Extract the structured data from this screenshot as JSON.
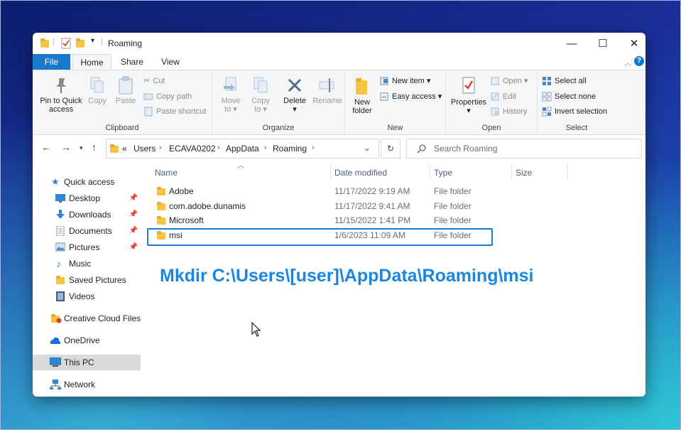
{
  "window": {
    "title": "Roaming",
    "controls": {
      "minimize": "—",
      "maximize": "☐",
      "close": "✕"
    }
  },
  "ribbon_tabs": [
    {
      "label": "File"
    },
    {
      "label": "Home"
    },
    {
      "label": "Share"
    },
    {
      "label": "View"
    }
  ],
  "ribbon": {
    "clipboard": {
      "label": "Clipboard",
      "pin_to_quick_access": [
        "Pin to Quick",
        "access"
      ],
      "copy": "Copy",
      "paste": "Paste",
      "cut": "Cut",
      "copy_path": "Copy path",
      "paste_shortcut": "Paste shortcut"
    },
    "organize": {
      "label": "Organize",
      "move_to": [
        "Move",
        "to"
      ],
      "copy_to": [
        "Copy",
        "to"
      ],
      "delete": "Delete",
      "rename": "Rename"
    },
    "new": {
      "label": "New",
      "new_folder": [
        "New",
        "folder"
      ],
      "new_item": "New item",
      "easy_access": "Easy access"
    },
    "open": {
      "label": "Open",
      "properties": "Properties",
      "open": "Open",
      "edit": "Edit",
      "history": "History"
    },
    "select": {
      "label": "Select",
      "select_all": "Select all",
      "select_none": "Select none",
      "invert_selection": "Invert selection"
    }
  },
  "address_bar": {
    "prefix": "«",
    "crumbs": [
      "Users",
      "ECAVA0202",
      "AppData",
      "Roaming"
    ],
    "search_placeholder": "Search Roaming"
  },
  "nav_pane": {
    "items": [
      {
        "label": "Quick access",
        "icon": "star-icon"
      },
      {
        "label": "Desktop",
        "icon": "desktop-icon",
        "pinned": true
      },
      {
        "label": "Downloads",
        "icon": "download-icon",
        "pinned": true
      },
      {
        "label": "Documents",
        "icon": "document-icon",
        "pinned": true
      },
      {
        "label": "Pictures",
        "icon": "picture-icon",
        "pinned": true
      },
      {
        "label": "Music",
        "icon": "music-icon"
      },
      {
        "label": "Saved Pictures",
        "icon": "folder-icon"
      },
      {
        "label": "Videos",
        "icon": "video-icon"
      },
      {
        "label": "Creative Cloud Files",
        "icon": "creative-cloud-icon"
      },
      {
        "label": "OneDrive",
        "icon": "cloud-icon"
      },
      {
        "label": "This PC",
        "icon": "computer-icon",
        "selected": true
      },
      {
        "label": "Network",
        "icon": "network-icon"
      }
    ]
  },
  "file_list": {
    "columns": [
      "Name",
      "Date modified",
      "Type",
      "Size"
    ],
    "rows": [
      {
        "name": "Adobe",
        "date": "11/17/2022 9:19 AM",
        "type": "File folder"
      },
      {
        "name": "com.adobe.dunamis",
        "date": "11/17/2022 9:41 AM",
        "type": "File folder"
      },
      {
        "name": "Microsoft",
        "date": "11/15/2022 1:41 PM",
        "type": "File folder"
      },
      {
        "name": "msi",
        "date": "1/6/2023 11:09 AM",
        "type": "File folder"
      }
    ]
  },
  "annotation": {
    "caption": "Mkdir C:\\Users\\[user]\\AppData\\Roaming\\msi"
  },
  "colors": {
    "accent": "#1979ca",
    "highlight_box": "#1a7ad4",
    "caption": "#1a86e0",
    "folder": "#f6c342"
  }
}
